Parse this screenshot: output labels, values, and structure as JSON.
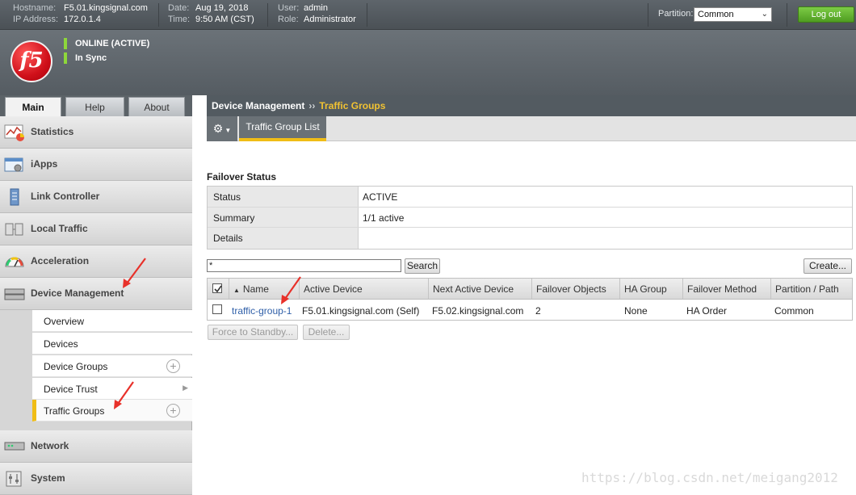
{
  "topbar": {
    "hostname_label": "Hostname:",
    "hostname": "F5.01.kingsignal.com",
    "ip_label": "IP Address:",
    "ip": "172.0.1.4",
    "date_label": "Date:",
    "date": "Aug 19, 2018",
    "time_label": "Time:",
    "time": "9:50 AM (CST)",
    "user_label": "User:",
    "user": "admin",
    "role_label": "Role:",
    "role": "Administrator",
    "partition_label": "Partition:",
    "partition_value": "Common",
    "logout_label": "Log out"
  },
  "header": {
    "logo_text": "f5",
    "status": "ONLINE (ACTIVE)",
    "sync": "In Sync",
    "status_color": "#8ed73a"
  },
  "nav_tabs": {
    "main": "Main",
    "help": "Help",
    "about": "About"
  },
  "leftnav": {
    "statistics": "Statistics",
    "iapps": "iApps",
    "link_controller": "Link Controller",
    "local_traffic": "Local Traffic",
    "acceleration": "Acceleration",
    "device_management": "Device Management",
    "sub": {
      "overview": "Overview",
      "devices": "Devices",
      "device_groups": "Device Groups",
      "device_trust": "Device Trust",
      "traffic_groups": "Traffic Groups"
    },
    "network": "Network",
    "system": "System"
  },
  "breadcrumb": {
    "section": "Device Management",
    "separator": "››",
    "current": "Traffic Groups"
  },
  "subtabs": {
    "list": "Traffic Group List"
  },
  "failover": {
    "title": "Failover Status",
    "rows": [
      {
        "key": "Status",
        "value": "ACTIVE"
      },
      {
        "key": "Summary",
        "value": "1/1 active"
      },
      {
        "key": "Details",
        "value": ""
      }
    ]
  },
  "filter": {
    "value": "*",
    "search_label": "Search",
    "create_label": "Create..."
  },
  "table": {
    "columns": [
      "Name",
      "Active Device",
      "Next Active Device",
      "Failover Objects",
      "HA Group",
      "Failover Method",
      "Partition / Path"
    ],
    "rows": [
      {
        "name": "traffic-group-1",
        "active_device": "F5.01.kingsignal.com (Self)",
        "next_active_device": "F5.02.kingsignal.com",
        "failover_objects": "2",
        "ha_group": "None",
        "failover_method": "HA Order",
        "partition": "Common"
      }
    ],
    "force_standby_label": "Force to Standby...",
    "delete_label": "Delete..."
  },
  "watermark": "https://blog.csdn.net/meigang2012",
  "colors": {
    "accent": "#f0bd16",
    "annotation_arrow": "#e8312a",
    "link": "#2f5fa8"
  }
}
